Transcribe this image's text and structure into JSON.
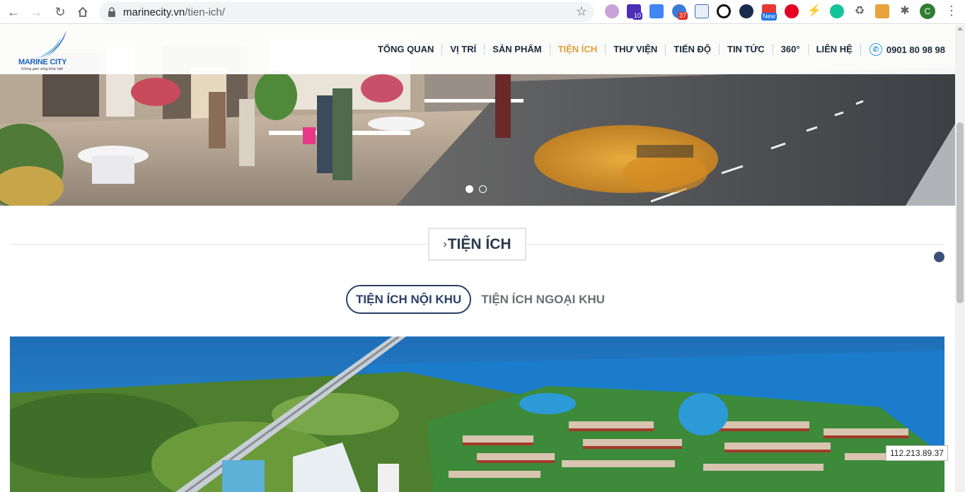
{
  "browser": {
    "url_host": "marinecity.vn",
    "url_path": "/tien-ich/",
    "ext_badges": [
      "10",
      "37",
      "New"
    ],
    "avatar_letter": "C"
  },
  "site": {
    "logo_text": "MARINE CITY",
    "logo_tagline": "Không gian sống khác biệt",
    "menu": [
      {
        "label": "TỔNG QUAN",
        "active": false
      },
      {
        "label": "VỊ TRÍ",
        "active": false
      },
      {
        "label": "SẢN PHẨM",
        "active": false
      },
      {
        "label": "TIỆN ÍCH",
        "active": true
      },
      {
        "label": "THƯ VIỆN",
        "active": false
      },
      {
        "label": "TIẾN ĐỘ",
        "active": false
      },
      {
        "label": "TIN TỨC",
        "active": false
      },
      {
        "label": "360°",
        "active": false
      },
      {
        "label": "LIÊN HỆ",
        "active": false
      }
    ],
    "phone": "0901 80 98 98",
    "accent_color": "#e0a03a",
    "primary_color": "#2a4066"
  },
  "section": {
    "title": "TIỆN ÍCH",
    "tabs": [
      {
        "label": "TIỆN ÍCH NỘI KHU",
        "active": true
      },
      {
        "label": "TIỆN ÍCH NGOẠI KHU",
        "active": false
      }
    ]
  },
  "slider": {
    "slides": 2,
    "current": 1
  },
  "ip_address": "112.213.89.37"
}
